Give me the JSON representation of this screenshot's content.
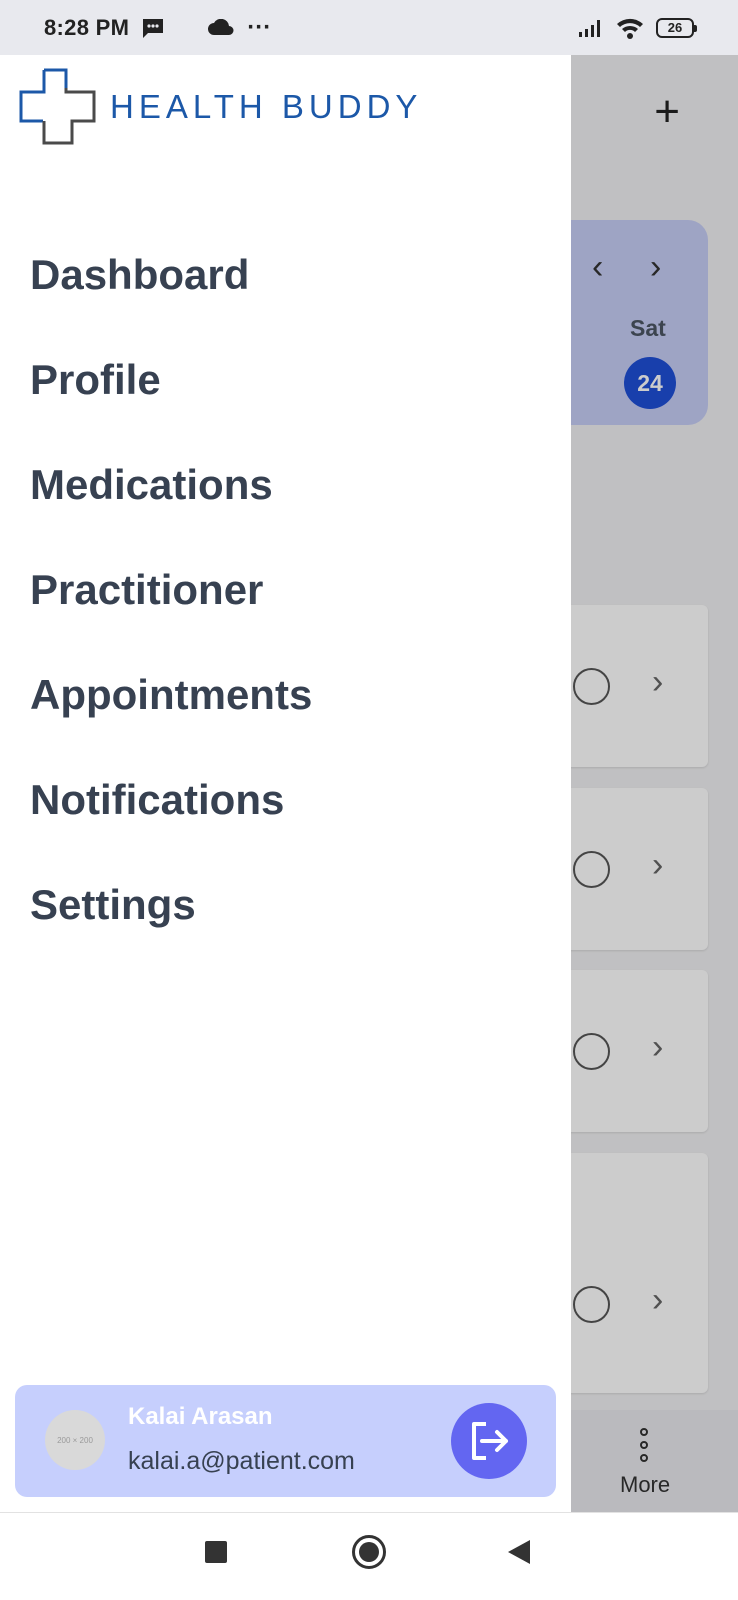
{
  "status_bar": {
    "time": "8:28 PM",
    "battery": "26",
    "more_dots": "···"
  },
  "brand": {
    "name": "HEALTH BUDDY",
    "color": "#1c58a8"
  },
  "menu": [
    {
      "label": "Dashboard"
    },
    {
      "label": "Profile"
    },
    {
      "label": "Medications"
    },
    {
      "label": "Practitioner"
    },
    {
      "label": "Appointments"
    },
    {
      "label": "Notifications"
    },
    {
      "label": "Settings"
    }
  ],
  "user": {
    "name": "Kalai Arasan",
    "email": "kalai.a@patient.com",
    "avatar_placeholder": "200 × 200"
  },
  "background_app": {
    "add_symbol": "+",
    "week": {
      "prev": "‹",
      "next": "›",
      "day": "Sat",
      "date": "24"
    },
    "list_chevron": "›",
    "more_label": "More"
  },
  "colors": {
    "accent": "#6366f1",
    "date_badge": "#1f4fd8",
    "user_card": "#c6cffd",
    "menu_text": "#374151"
  }
}
